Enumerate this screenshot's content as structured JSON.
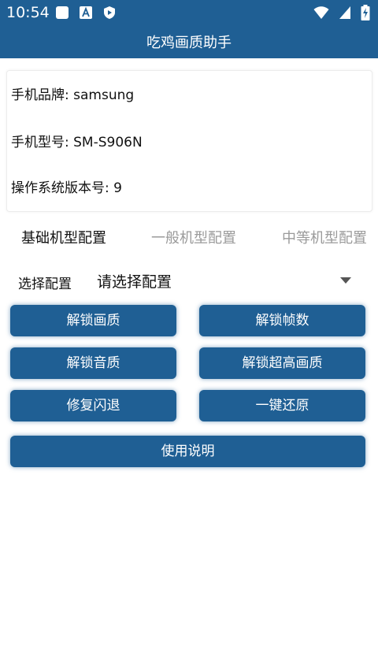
{
  "status_bar": {
    "time": "10:54",
    "icons_left": [
      "square-notification-icon",
      "a-notification-icon",
      "shield-play-icon"
    ],
    "icons_right": [
      "wifi-icon",
      "signal-icon",
      "battery-charging-icon"
    ]
  },
  "app_bar": {
    "title": "吃鸡画质助手"
  },
  "device_info": {
    "brand_line": "手机品牌: samsung",
    "model_line": "手机型号: SM-S906N",
    "os_line": "操作系统版本号: 9"
  },
  "tabs": [
    {
      "label": "基础机型配置",
      "active": true
    },
    {
      "label": "一般机型配置",
      "active": false
    },
    {
      "label": "中等机型配置",
      "active": false
    }
  ],
  "config_select": {
    "label": "选择配置",
    "value": "请选择配置"
  },
  "buttons": {
    "unlock_quality": "解锁画质",
    "unlock_fps": "解锁帧数",
    "unlock_audio": "解锁音质",
    "unlock_ultra": "解锁超高画质",
    "fix_crash": "修复闪退",
    "one_key_restore": "一键还原",
    "instructions": "使用说明"
  },
  "colors": {
    "primary": "#1f5f94",
    "text": "#111111",
    "inactive_tab": "#9a9a9a"
  }
}
